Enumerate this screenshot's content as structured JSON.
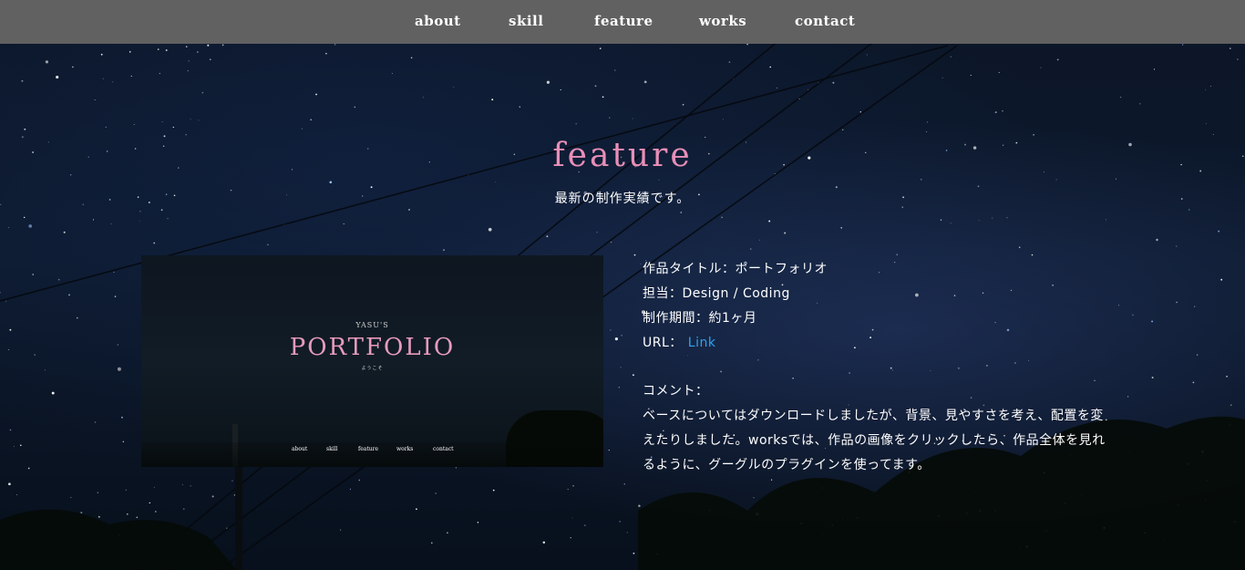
{
  "nav": {
    "items": [
      {
        "label": "about"
      },
      {
        "label": "skill"
      },
      {
        "label": "feature"
      },
      {
        "label": "works"
      },
      {
        "label": "contact"
      }
    ]
  },
  "section": {
    "title": "feature",
    "subtitle": "最新の制作実績です。"
  },
  "thumbnail": {
    "small_text": "YASU'S",
    "title": "PORTFOLIO",
    "tagline": "ようこそ",
    "nav": [
      "about",
      "skill",
      "feature",
      "works",
      "contact"
    ]
  },
  "details": {
    "title_line": "作品タイトル：ポートフォリオ",
    "role_line": "担当：Design / Coding",
    "period_line": "制作期間：約1ヶ月",
    "url_label": "URL：",
    "url_link": "Link",
    "comment_label": "コメント：",
    "comment_body": "ベースについてはダウンロードしましたが、背景、見やすさを考え、配置を変えたりしました。worksでは、作品の画像をクリックしたら、作品全体を見れるように、グーグルのプラグインを使ってます。"
  },
  "colors": {
    "nav_bg": "#616161",
    "accent_pink": "#e88fb8",
    "link_blue": "#2ea3f2",
    "sky": "#0b1526"
  }
}
